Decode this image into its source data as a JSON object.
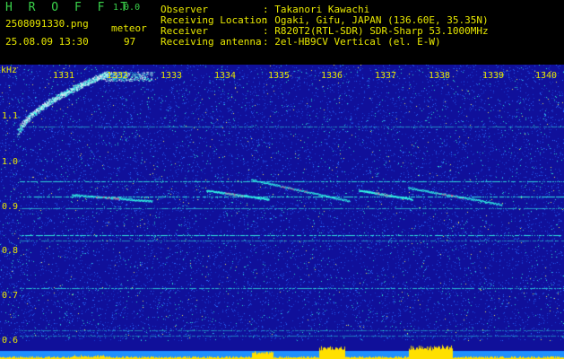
{
  "header": {
    "app_title": "H R O F F T",
    "app_version": "1.0.0",
    "filename": "2508091330.png",
    "datetime": "25.08.09 13:30",
    "meteor_label": "meteor",
    "meteor_count": "97",
    "info": [
      {
        "label": "Observer",
        "value": ": Takanori Kawachi"
      },
      {
        "label": "Receiving Location",
        "value": ": Ogaki, Gifu, JAPAN (136.60E, 35.35N)"
      },
      {
        "label": "Receiver",
        "value": ": R820T2(RTL-SDR) SDR-Sharp 53.1000MHz"
      },
      {
        "label": "Receiving antenna",
        "value": ": 2el-HB9CV Vertical (el. E-W)"
      }
    ]
  },
  "spectrogram": {
    "unit_label": "kHz",
    "y_ticks": [
      "1.1",
      "1.0",
      "0.9",
      "0.8",
      "0.7",
      "0.6"
    ],
    "x_ticks": [
      "1331",
      "1332",
      "1333",
      "1334",
      "1335",
      "1336",
      "1337",
      "1338",
      "1339",
      "1340"
    ],
    "colors": {
      "background": "#10109a",
      "noise_low": "#2a6cff",
      "noise_high": "#2ee0d0",
      "trace": "#33ffe8",
      "meteor_peak": "#ff6688",
      "bottom_bar": "#1e90ff",
      "bottom_peak": "#ffe000",
      "header_text": "#e8e800",
      "title_text": "#3ad24a"
    }
  }
}
